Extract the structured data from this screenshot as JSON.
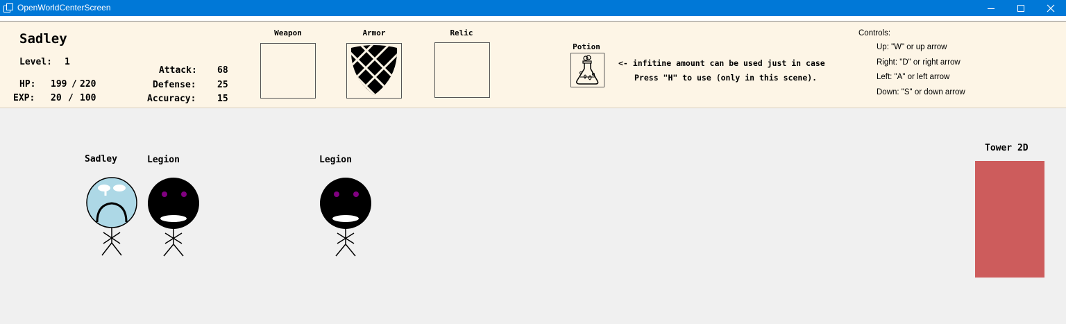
{
  "window": {
    "title": "OpenWorldCenterScreen"
  },
  "player": {
    "name": "Sadley",
    "level_label": "Level:",
    "level": "1",
    "hp_label": "HP:",
    "hp": "199",
    "hp_sep": "/",
    "hp_max": "220",
    "exp_label": "EXP:",
    "exp": "20",
    "exp_sep": "/",
    "exp_max": "100",
    "attack_label": "Attack:",
    "attack": "68",
    "defense_label": "Defense:",
    "defense": "25",
    "accuracy_label": "Accuracy:",
    "accuracy": "15"
  },
  "equipment": {
    "weapon_label": "Weapon",
    "armor_label": "Armor",
    "relic_label": "Relic",
    "potion_label": "Potion"
  },
  "potion_note": {
    "line1": "<- infitine amount can be used just in case",
    "line2": "Press \"H\" to use (only in this scene)."
  },
  "controls": {
    "title": "Controls:",
    "up": "Up: \"W\" or up arrow",
    "right": "Right: \"D\" or right arrow",
    "left": "Left: \"A\" or left arrow",
    "down": "Down: \"S\" or down arrow"
  },
  "scene": {
    "player_name": "Sadley",
    "enemy1_name": "Legion",
    "enemy2_name": "Legion",
    "tower_label": "Tower 2D",
    "tower_color": "#cd5c5c"
  }
}
